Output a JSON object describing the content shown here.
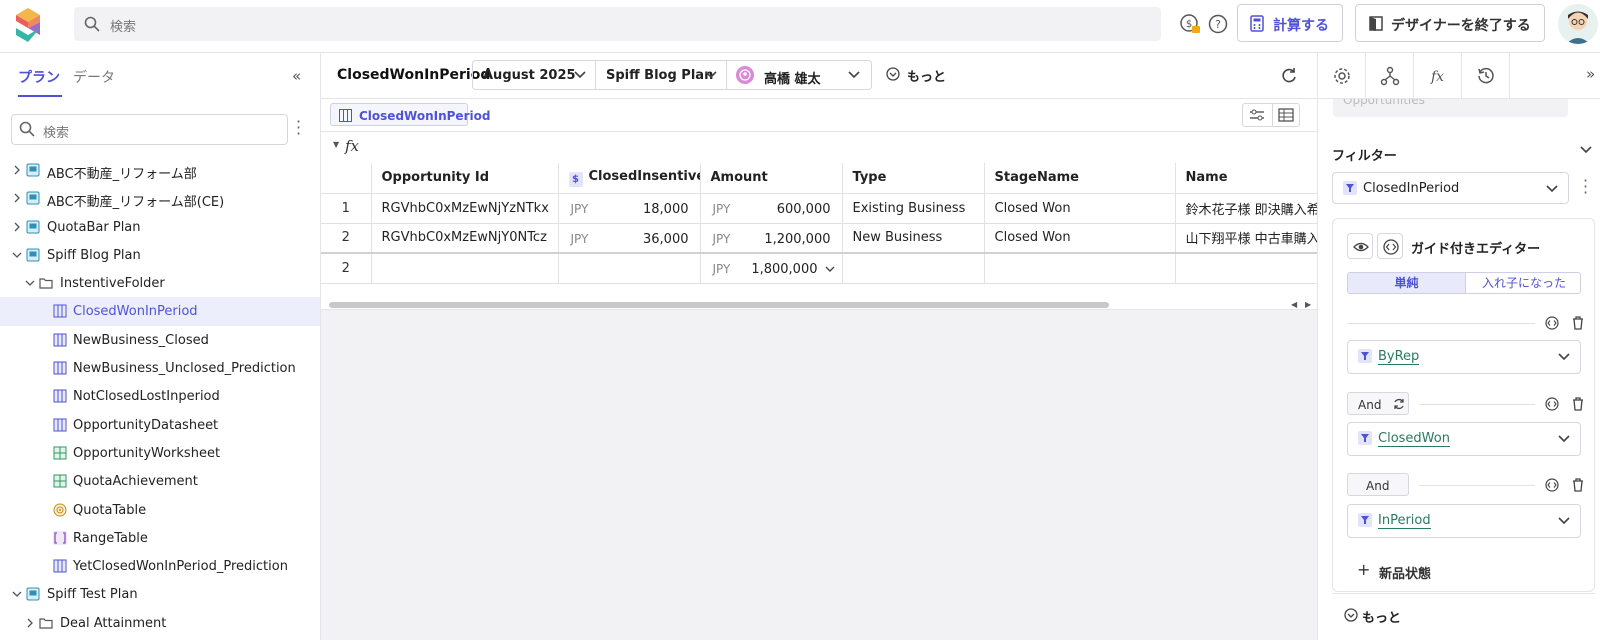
{
  "topbar": {
    "search_placeholder": "検索",
    "calc_button": "計算する",
    "exit_designer_button": "デザイナーを終了する"
  },
  "left": {
    "tabs": [
      "プラン",
      "データ"
    ],
    "search_placeholder": "検索",
    "tree": [
      {
        "label": "ABC不動産_リフォーム部",
        "level": 0,
        "expanded": false,
        "icon": "plan-icon"
      },
      {
        "label": "ABC不動産_リフォーム部(CE)",
        "level": 0,
        "expanded": false,
        "icon": "plan-icon"
      },
      {
        "label": "QuotaBar Plan",
        "level": 0,
        "expanded": false,
        "icon": "plan-icon"
      },
      {
        "label": "Spiff Blog Plan",
        "level": 0,
        "expanded": true,
        "icon": "plan-icon"
      },
      {
        "label": "InstentiveFolder",
        "level": 1,
        "expanded": true,
        "icon": "folder-icon"
      },
      {
        "label": "ClosedWonInPeriod",
        "level": 2,
        "icon": "datasheet-icon",
        "selected": true
      },
      {
        "label": "NewBusiness_Closed",
        "level": 2,
        "icon": "datasheet-icon"
      },
      {
        "label": "NewBusiness_Unclosed_Prediction",
        "level": 2,
        "icon": "datasheet-icon"
      },
      {
        "label": "NotClosedLostInperiod",
        "level": 2,
        "icon": "datasheet-icon"
      },
      {
        "label": "OpportunityDatasheet",
        "level": 2,
        "icon": "datasheet-icon"
      },
      {
        "label": "OpportunityWorksheet",
        "level": 2,
        "icon": "worksheet-icon"
      },
      {
        "label": "QuotaAchievement",
        "level": 2,
        "icon": "worksheet-icon"
      },
      {
        "label": "QuotaTable",
        "level": 2,
        "icon": "target-icon"
      },
      {
        "label": "RangeTable",
        "level": 2,
        "icon": "range-icon"
      },
      {
        "label": "YetClosedWonInPeriod_Prediction",
        "level": 2,
        "icon": "datasheet-icon"
      },
      {
        "label": "Spiff Test Plan",
        "level": 0,
        "expanded": true,
        "icon": "plan-icon"
      },
      {
        "label": "Deal Attainment",
        "level": 1,
        "expanded": false,
        "icon": "folder-icon"
      }
    ]
  },
  "mid": {
    "title": "ClosedWonInPeriod",
    "period": "August 2025",
    "plan": "Spiff Blog Plan",
    "user": "高橋 雄太",
    "more": "もっと",
    "chip": "ClosedWonInPeriod",
    "columns": [
      "",
      "Opportunity Id",
      "ClosedInsentive",
      "Amount",
      "Type",
      "StageName",
      "Name"
    ],
    "rows": [
      {
        "n": "1",
        "id": "RGVhbC0xMzEwNjYzNTkx",
        "inc_cur": "JPY",
        "inc": "18,000",
        "amt_cur": "JPY",
        "amt": "600,000",
        "type": "Existing Business",
        "stage": "Closed Won",
        "name": "鈴木花子様 即決購入希"
      },
      {
        "n": "2",
        "id": "RGVhbC0xMzEwNjY0NTcz",
        "inc_cur": "JPY",
        "inc": "36,000",
        "amt_cur": "JPY",
        "amt": "1,200,000",
        "type": "New Business",
        "stage": "Closed Won",
        "name": "山下翔平様 中古車購入"
      }
    ],
    "total": {
      "n": "2",
      "amt_cur": "JPY",
      "amt": "1,800,000"
    }
  },
  "right": {
    "ghost_value": "Opportunities",
    "filter_heading": "フィルター",
    "filter_select": "ClosedInPeriod",
    "editor_title": "ガイド付きエディター",
    "seg_simple": "単純",
    "seg_nested": "入れ子になった",
    "and1": "And",
    "and2": "And",
    "conditions": [
      "ByRep",
      "ClosedWon",
      "InPeriod"
    ],
    "new_condition": "新品状態",
    "more": "もっと"
  },
  "colors": {
    "accent": "#4f52d6",
    "link_green": "#2a7a5e",
    "selected_row": "#eceefb"
  }
}
